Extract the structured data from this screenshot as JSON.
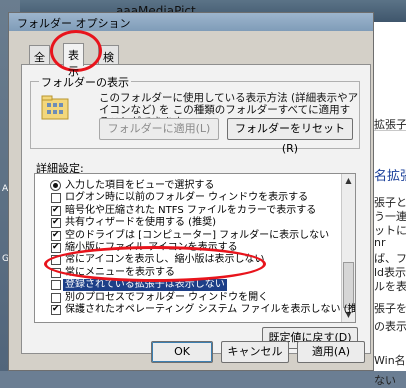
{
  "background": {
    "window_title": "aaaMediaPict",
    "desktop_labels": [
      "Ac",
      "Gc"
    ],
    "right_snippets": [
      "拡張子",
      "名拡張",
      "張子と",
      "う一連",
      "ットに",
      "nr",
      "ば、フ",
      "ld表示",
      "ルを表",
      "張子を",
      "の表示",
      "Win名拡",
      "ない"
    ]
  },
  "dialog": {
    "title": "フォルダー オプション",
    "tabs": [
      "全般",
      "表示",
      "検索"
    ],
    "active_tab": "表示",
    "folder_view": {
      "group_label": "フォルダーの表示",
      "description": "このフォルダーに使用している表示方法 (詳細表示やアイコンなど) を この種類のフォルダーすべてに適用することができます。",
      "apply_to_folders_label": "フォルダーに適用(L)",
      "reset_folders_label": "フォルダーをリセット(R)"
    },
    "advanced_label": "詳細設定:",
    "advanced_items": [
      {
        "type": "radio",
        "checked": true,
        "label": "入力した項目をビューで選択する"
      },
      {
        "type": "checkbox",
        "checked": false,
        "label": "ログオン時に以前のフォルダー ウィンドウを表示する"
      },
      {
        "type": "checkbox",
        "checked": true,
        "label": "暗号化や圧縮された NTFS ファイルをカラーで表示する"
      },
      {
        "type": "checkbox",
        "checked": true,
        "label": "共有ウィザードを使用する (推奨)"
      },
      {
        "type": "checkbox",
        "checked": true,
        "label": "空のドライブは [コンピューター] フォルダーに表示しない"
      },
      {
        "type": "checkbox",
        "checked": true,
        "label": "縮小版にファイル アイコンを表示する"
      },
      {
        "type": "checkbox",
        "checked": false,
        "label": "常にアイコンを表示し、縮小版は表示しない"
      },
      {
        "type": "checkbox",
        "checked": false,
        "label": "常にメニューを表示する"
      },
      {
        "type": "checkbox",
        "checked": false,
        "label": "登録されている拡張子は表示しない",
        "highlight": true
      },
      {
        "type": "checkbox",
        "checked": false,
        "label": "別のプロセスでフォルダー ウィンドウを開く"
      },
      {
        "type": "checkbox",
        "checked": true,
        "label": "保護されたオペレーティング システム ファイルを表示しない (推奨)"
      }
    ],
    "restore_defaults_label": "既定値に戻す(D)",
    "ok_label": "OK",
    "cancel_label": "キャンセル",
    "apply_label": "適用(A)",
    "annotation_color": "#e8141c",
    "highlight_color": "#1d3f88"
  }
}
